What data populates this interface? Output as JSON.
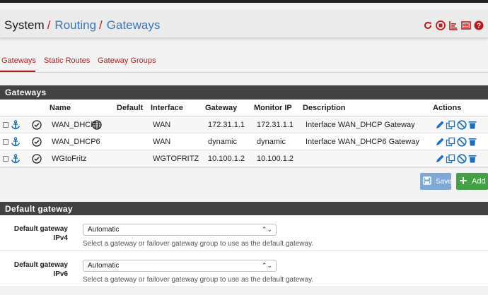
{
  "breadcrumb": {
    "root": "System",
    "level1": "Routing",
    "level2": "Gateways",
    "sep": "/"
  },
  "tabs": [
    {
      "label": "Gateways"
    },
    {
      "label": "Static Routes"
    },
    {
      "label": "Gateway Groups"
    }
  ],
  "gateways_panel": {
    "title": "Gateways",
    "columns": [
      "Name",
      "Default",
      "Interface",
      "Gateway",
      "Monitor IP",
      "Description",
      "Actions"
    ],
    "rows": [
      {
        "name": "WAN_DHCP",
        "interface": "WAN",
        "gateway": "172.31.1.1",
        "monitor_ip": "172.31.1.1",
        "description": "Interface WAN_DHCP Gateway"
      },
      {
        "name": "WAN_DHCP6",
        "interface": "WAN",
        "gateway": "dynamic",
        "monitor_ip": "dynamic",
        "description": "Interface WAN_DHCP6 Gateway"
      },
      {
        "name": "WGtoFritz",
        "interface": "WGTOFRITZ",
        "gateway": "10.100.1.2",
        "monitor_ip": "10.100.1.2",
        "description": ""
      }
    ]
  },
  "buttons": {
    "save": "Save",
    "add": "Add"
  },
  "default_gateway": {
    "title": "Default gateway",
    "ipv4": {
      "label_line1": "Default gateway",
      "label_line2": "IPv4",
      "value": "Automatic",
      "help": "Select a gateway or failover gateway group to use as the default gateway."
    },
    "ipv6": {
      "label_line1": "Default gateway",
      "label_line2": "IPv6",
      "value": "Automatic",
      "help": "Select a gateway or failover gateway group to use as the default gateway."
    }
  },
  "colors": {
    "accent": "#b71c1c",
    "link": "#3d75b0",
    "panel_header": "#424242",
    "icon_blue": "#1e6fb8",
    "save": "#80a8d6",
    "add": "#43a047"
  }
}
